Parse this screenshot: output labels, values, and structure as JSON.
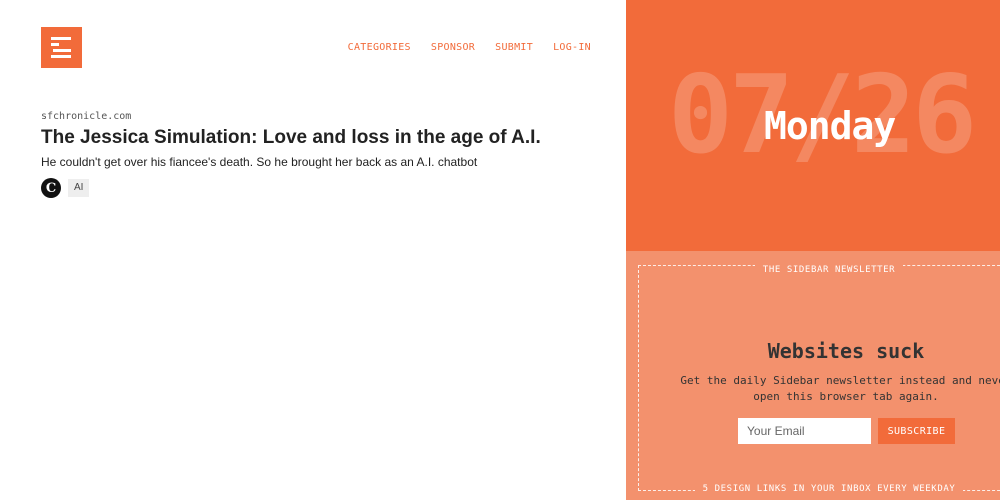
{
  "header": {
    "logo_icon": "sidebar-logo-icon",
    "nav": [
      {
        "label": "CATEGORIES"
      },
      {
        "label": "SPONSOR"
      },
      {
        "label": "SUBMIT"
      },
      {
        "label": "LOG-IN"
      }
    ]
  },
  "post": {
    "source": "sfchronicle.com",
    "title": "The Jessica Simulation: Love and loss in the age of A.I.",
    "description": "He couldn't get over his fiancee's death. So he brought her back as an A.I. chatbot",
    "source_icon_glyph": "C",
    "source_icon": "chronicle-icon",
    "tag": "AI"
  },
  "date_panel": {
    "date": "07/26",
    "weekday": "Monday"
  },
  "newsletter": {
    "label": "THE SIDEBAR NEWSLETTER",
    "headline": "Websites suck",
    "pitch": "Get the daily Sidebar newsletter instead and never open this browser tab again.",
    "email_placeholder": "Your Email",
    "subscribe_label": "SUBSCRIBE",
    "footer": "5 DESIGN LINKS IN YOUR INBOX EVERY WEEKDAY"
  },
  "colors": {
    "accent": "#f26b3a",
    "panel_light": "#f3916d"
  }
}
